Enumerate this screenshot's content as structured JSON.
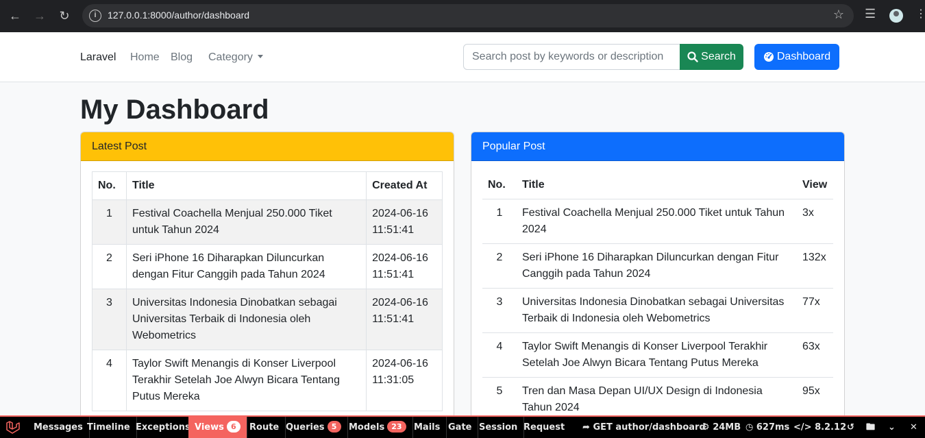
{
  "browser": {
    "url": "127.0.0.1:8000/author/dashboard"
  },
  "navbar": {
    "brand": "Laravel",
    "links": [
      "Home",
      "Blog"
    ],
    "category": "Category",
    "search_placeholder": "Search post by keywords or description",
    "search_label": "Search",
    "dashboard_label": "Dashboard"
  },
  "page": {
    "title": "My Dashboard"
  },
  "latest": {
    "header": "Latest Post",
    "columns": [
      "No.",
      "Title",
      "Created At"
    ],
    "rows": [
      {
        "no": "1",
        "title": "Festival Coachella Menjual 250.000 Tiket untuk Tahun 2024",
        "created": "2024-06-16 11:51:41"
      },
      {
        "no": "2",
        "title": "Seri iPhone 16 Diharapkan Diluncurkan dengan Fitur Canggih pada Tahun 2024",
        "created": "2024-06-16 11:51:41"
      },
      {
        "no": "3",
        "title": "Universitas Indonesia Dinobatkan sebagai Universitas Terbaik di Indonesia oleh Webometrics",
        "created": "2024-06-16 11:51:41"
      },
      {
        "no": "4",
        "title": "Taylor Swift Menangis di Konser Liverpool Terakhir Setelah Joe Alwyn Bicara Tentang Putus Mereka",
        "created": "2024-06-16 11:31:05"
      }
    ]
  },
  "popular": {
    "header": "Popular Post",
    "columns": [
      "No.",
      "Title",
      "View"
    ],
    "rows": [
      {
        "no": "1",
        "title": "Festival Coachella Menjual 250.000 Tiket untuk Tahun 2024",
        "view": "3x"
      },
      {
        "no": "2",
        "title": "Seri iPhone 16 Diharapkan Diluncurkan dengan Fitur Canggih pada Tahun 2024",
        "view": "132x"
      },
      {
        "no": "3",
        "title": "Universitas Indonesia Dinobatkan sebagai Universitas Terbaik di Indonesia oleh Webometrics",
        "view": "77x"
      },
      {
        "no": "4",
        "title": "Taylor Swift Menangis di Konser Liverpool Terakhir Setelah Joe Alwyn Bicara Tentang Putus Mereka",
        "view": "63x"
      },
      {
        "no": "5",
        "title": "Tren dan Masa Depan UI/UX Design di Indonesia Tahun 2024",
        "view": "95x"
      }
    ]
  },
  "debugbar": {
    "tabs": [
      {
        "label": "Messages",
        "badge": ""
      },
      {
        "label": "Timeline",
        "badge": ""
      },
      {
        "label": "Exceptions",
        "badge": ""
      },
      {
        "label": "Views",
        "badge": "6"
      },
      {
        "label": "Route",
        "badge": ""
      },
      {
        "label": "Queries",
        "badge": "5"
      },
      {
        "label": "Models",
        "badge": "23"
      },
      {
        "label": "Mails",
        "badge": ""
      },
      {
        "label": "Gate",
        "badge": ""
      },
      {
        "label": "Session",
        "badge": ""
      },
      {
        "label": "Request",
        "badge": ""
      }
    ],
    "request": "GET author/dashboard",
    "memory": "24MB",
    "time": "627ms",
    "php": "8.2.12"
  },
  "colors": {
    "latest_header": "#ffc107",
    "popular_header": "#0d6efd",
    "search_button": "#198754",
    "dashboard_button": "#0d6efd",
    "debugbar_accent": "#f4645f"
  }
}
